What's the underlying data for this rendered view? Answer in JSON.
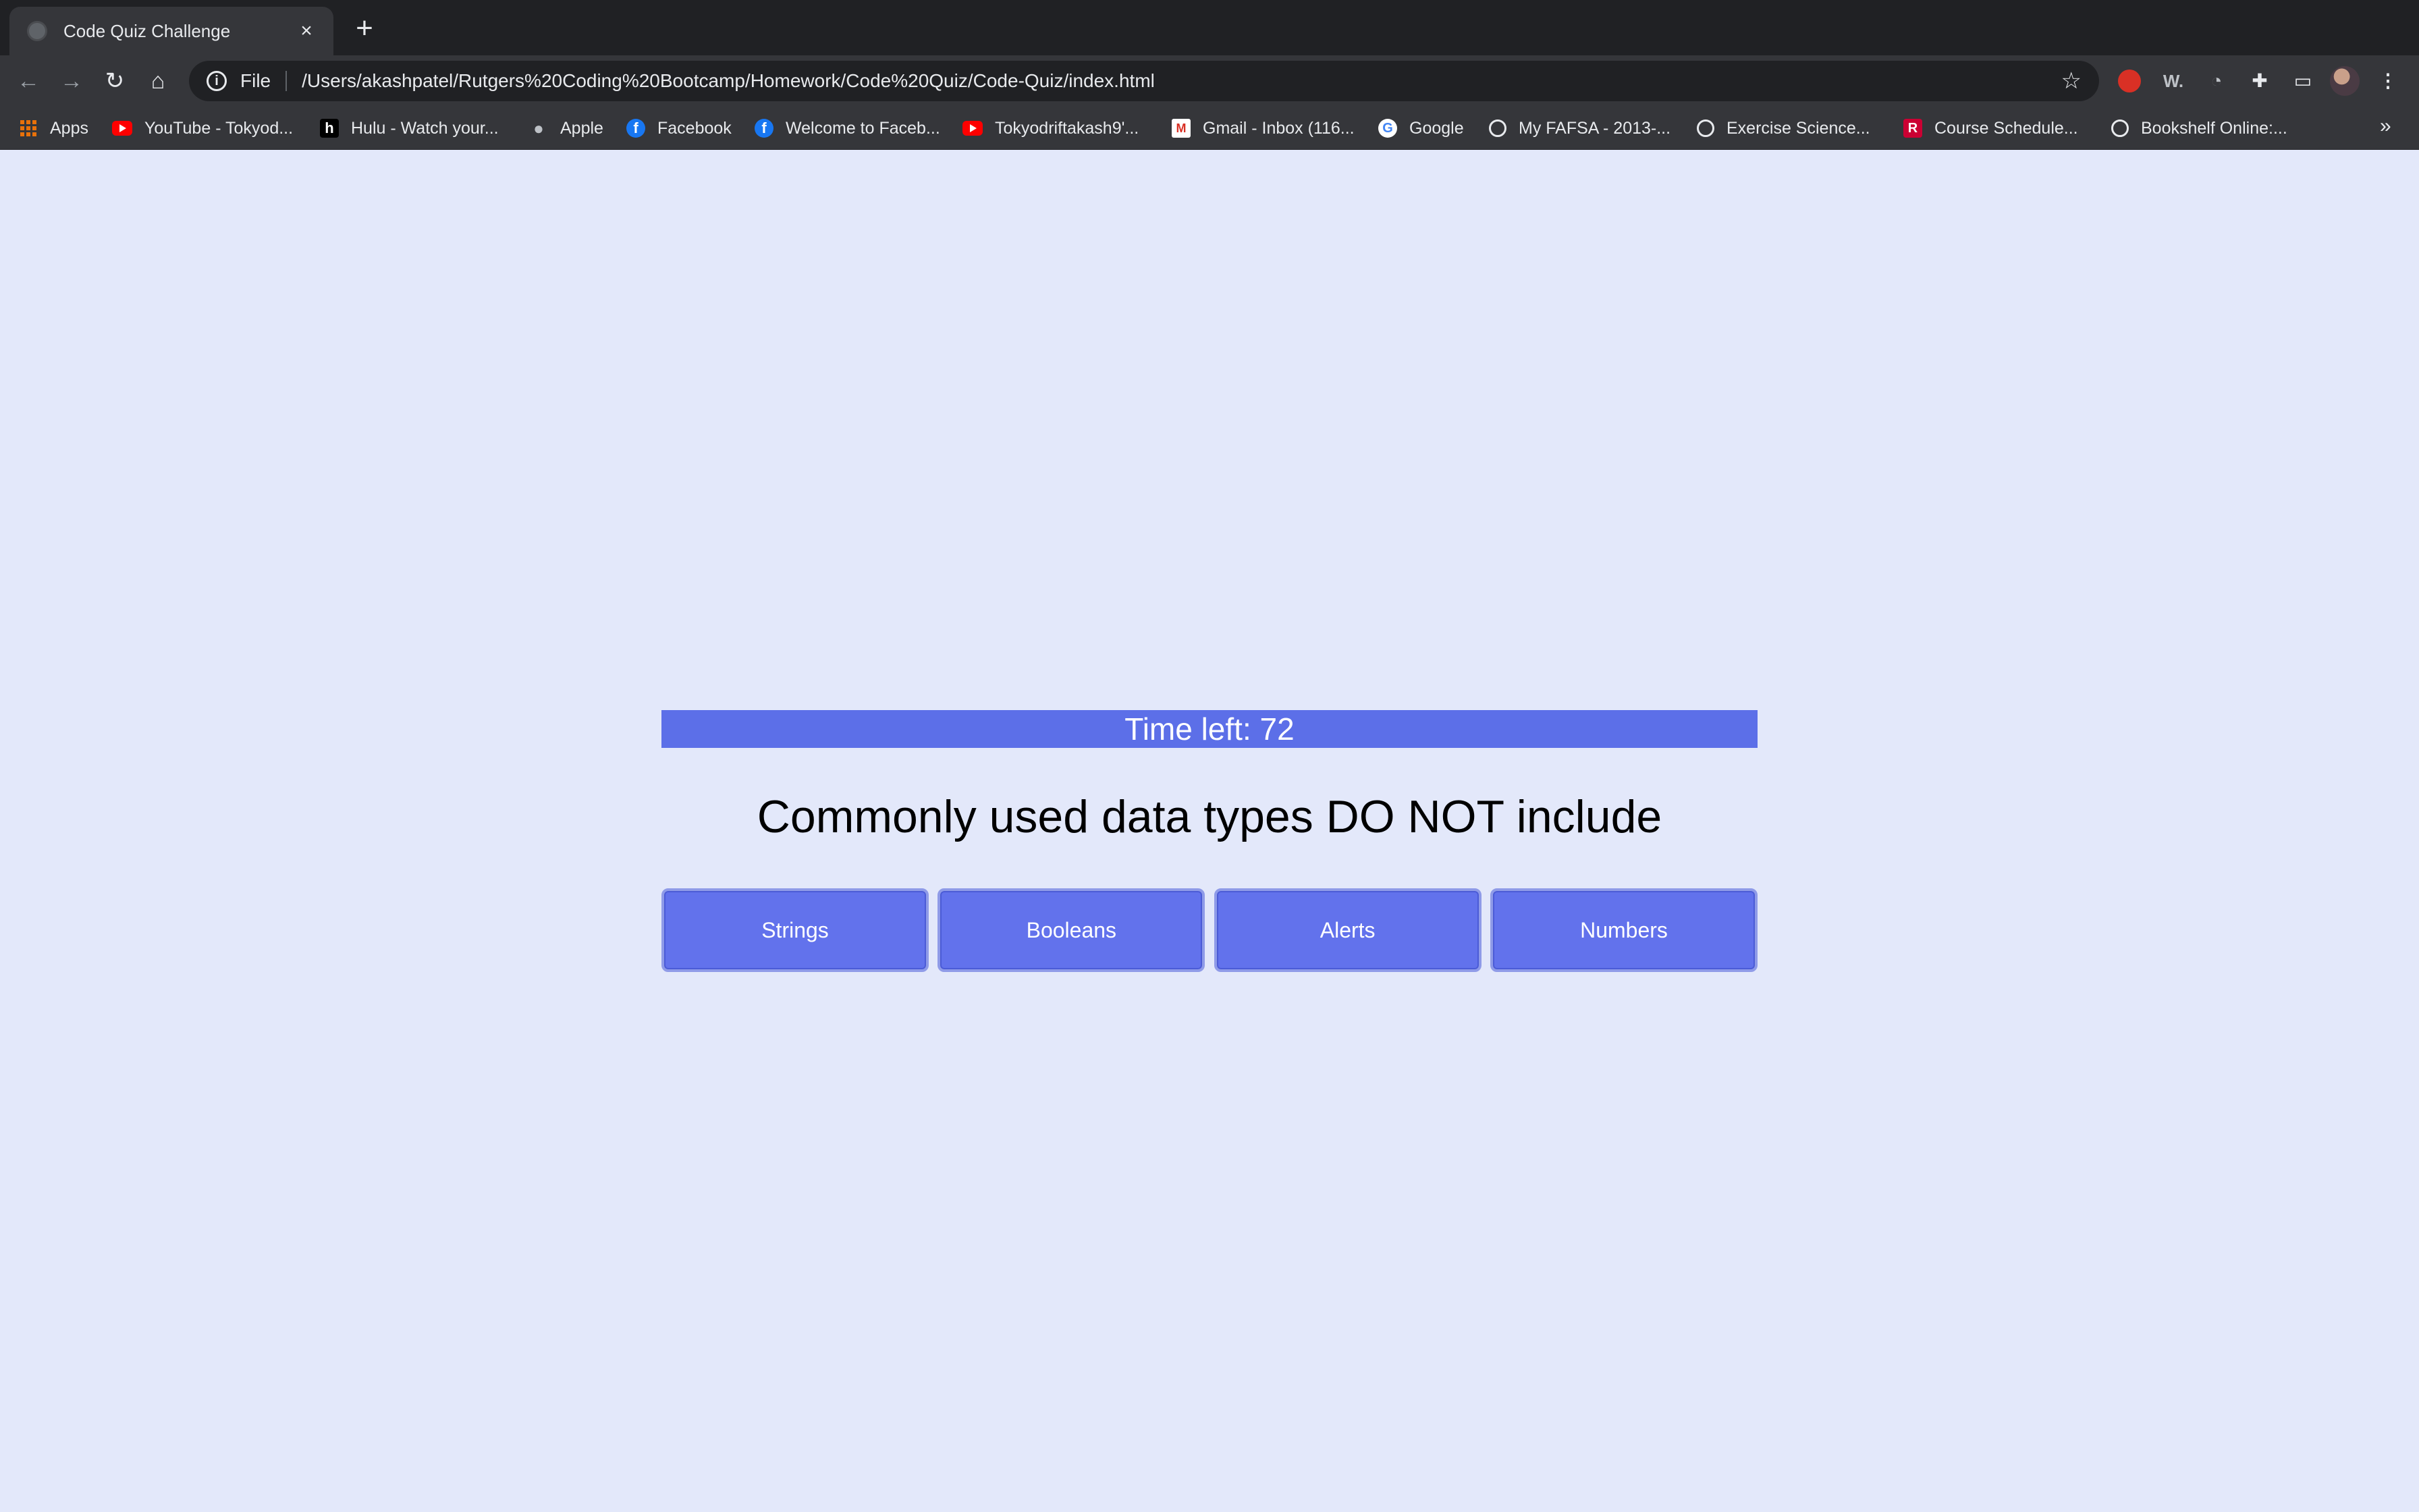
{
  "browser": {
    "tab_title": "Code Quiz Challenge",
    "tab_close": "×",
    "new_tab": "+",
    "address_scheme": "File",
    "address_url": "/Users/akashpatel/Rutgers%20Coding%20Bootcamp/Homework/Code%20Quiz/Code-Quiz/index.html",
    "bookmarks": [
      {
        "label": "Apps",
        "icon": "apps-grid-icon"
      },
      {
        "label": "YouTube - Tokyod...",
        "icon": "youtube-icon"
      },
      {
        "label": "Hulu - Watch your...",
        "icon": "hulu-icon"
      },
      {
        "label": "Apple",
        "icon": "apple-icon"
      },
      {
        "label": "Facebook",
        "icon": "facebook-icon"
      },
      {
        "label": "Welcome to Faceb...",
        "icon": "facebook-icon"
      },
      {
        "label": "Tokyodriftakash9'...",
        "icon": "youtube-icon"
      },
      {
        "label": "Gmail - Inbox (116...",
        "icon": "gmail-icon"
      },
      {
        "label": "Google",
        "icon": "google-icon"
      },
      {
        "label": "My FAFSA - 2013-...",
        "icon": "globe-icon"
      },
      {
        "label": "Exercise Science...",
        "icon": "globe-icon"
      },
      {
        "label": "Course Schedule...",
        "icon": "rutgers-icon"
      },
      {
        "label": "Bookshelf Online:...",
        "icon": "globe-icon"
      }
    ],
    "bookmarks_more": "»"
  },
  "quiz": {
    "timer_label": "Time left: 72",
    "question": "Commonly used data types DO NOT include",
    "choices": [
      "Strings",
      "Booleans",
      "Alerts",
      "Numbers"
    ]
  },
  "colors": {
    "page_background": "#e3e8fa",
    "accent": "#5c6fe8",
    "button": "#6272ec"
  }
}
